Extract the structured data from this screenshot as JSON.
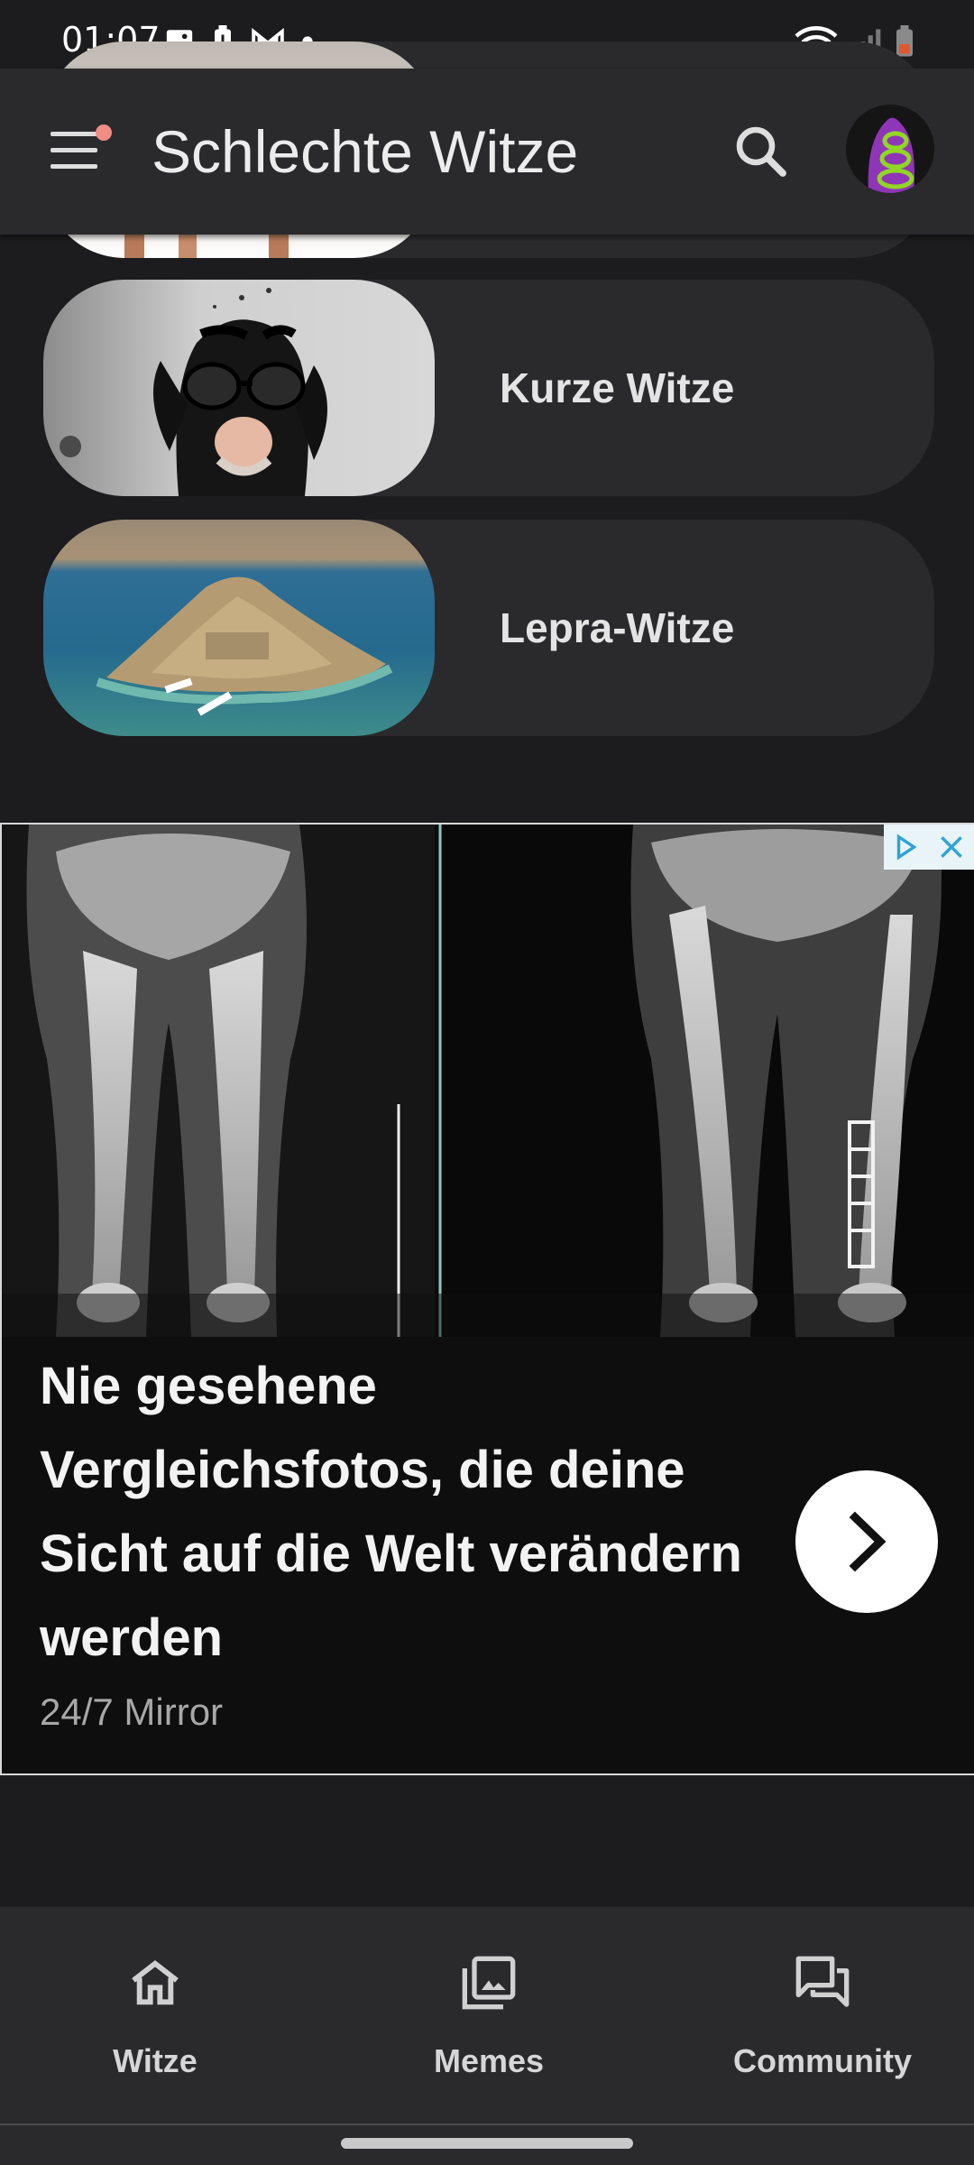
{
  "status_bar": {
    "time": "01:07",
    "left_icons": [
      "gallery-icon",
      "battery-alert-icon",
      "gmail-icon",
      "notification-dot-icon"
    ],
    "right_icons": [
      "wifi-icon",
      "signal-icon",
      "battery-icon"
    ]
  },
  "app_bar": {
    "title": "Schlechte Witze",
    "menu_icon": "menu-icon",
    "has_notification_dot": true,
    "search_icon": "search-icon",
    "avatar_icon": "avatar"
  },
  "categories": [
    {
      "label": "",
      "image": "partial-photo"
    },
    {
      "label": "Kurze Witze",
      "image": "dog-with-glasses-photo"
    },
    {
      "label": "Lepra-Witze",
      "image": "island-photo"
    }
  ],
  "ad": {
    "headline": "Nie gesehene Vergleichsfotos, die deine Sicht auf die Welt verändern werden",
    "source": "24/7 Mirror",
    "image": "xray-legs-photo",
    "cta_icon": "chevron-right-icon",
    "badges": [
      "adchoices-icon",
      "close-icon"
    ]
  },
  "bottom_nav": [
    {
      "label": "Witze",
      "icon": "home-icon"
    },
    {
      "label": "Memes",
      "icon": "gallery-icon"
    },
    {
      "label": "Community",
      "icon": "forum-icon"
    }
  ],
  "colors": {
    "background": "#1c1c1e",
    "surface": "#2a2a2d",
    "text": "#e4e4e4",
    "notification_dot": "#f08d84"
  }
}
